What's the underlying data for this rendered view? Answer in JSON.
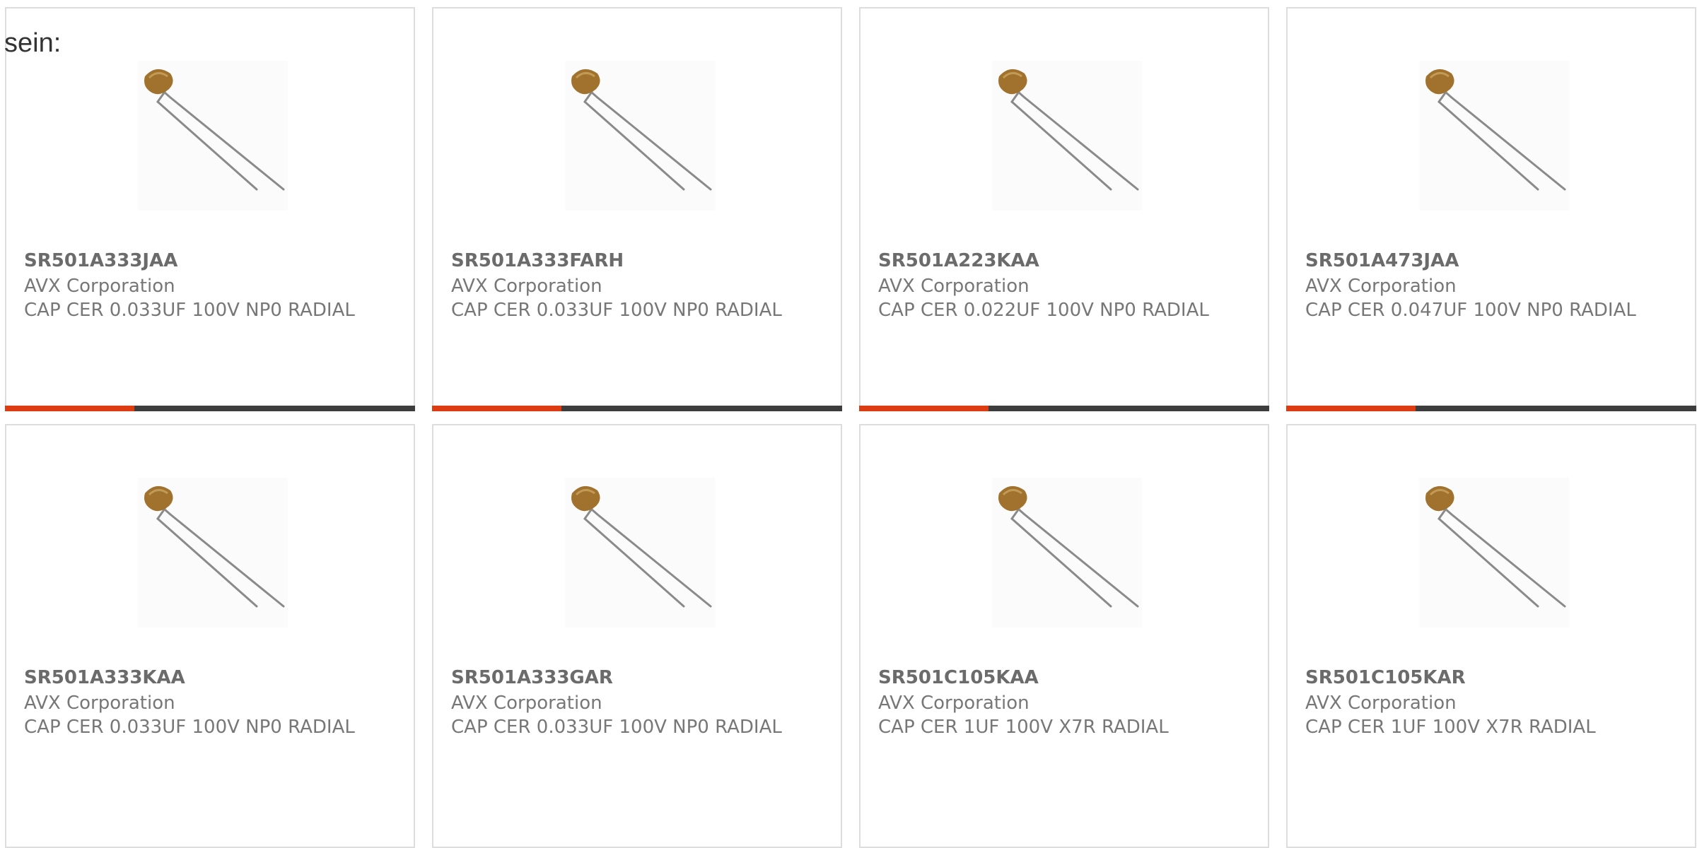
{
  "intro_text": "sein:",
  "colors": {
    "accent": "#dd3b12",
    "bar": "#3d3d3d",
    "border": "#dddddd"
  },
  "products": [
    {
      "part": "SR501A333JAA",
      "manufacturer": "AVX Corporation",
      "description": "CAP CER 0.033UF 100V NP0 RADIAL",
      "image_icon": "ceramic-capacitor-icon"
    },
    {
      "part": "SR501A333FARH",
      "manufacturer": "AVX Corporation",
      "description": "CAP CER 0.033UF 100V NP0 RADIAL",
      "image_icon": "ceramic-capacitor-icon"
    },
    {
      "part": "SR501A223KAA",
      "manufacturer": "AVX Corporation",
      "description": "CAP CER 0.022UF 100V NP0 RADIAL",
      "image_icon": "ceramic-capacitor-icon"
    },
    {
      "part": "SR501A473JAA",
      "manufacturer": "AVX Corporation",
      "description": "CAP CER 0.047UF 100V NP0 RADIAL",
      "image_icon": "ceramic-capacitor-icon"
    },
    {
      "part": "SR501A333KAA",
      "manufacturer": "AVX Corporation",
      "description": "CAP CER 0.033UF 100V NP0 RADIAL",
      "image_icon": "ceramic-capacitor-icon"
    },
    {
      "part": "SR501A333GAR",
      "manufacturer": "AVX Corporation",
      "description": "CAP CER 0.033UF 100V NP0 RADIAL",
      "image_icon": "ceramic-capacitor-icon"
    },
    {
      "part": "SR501C105KAA",
      "manufacturer": "AVX Corporation",
      "description": "CAP CER 1UF 100V X7R RADIAL",
      "image_icon": "ceramic-capacitor-icon"
    },
    {
      "part": "SR501C105KAR",
      "manufacturer": "AVX Corporation",
      "description": "CAP CER 1UF 100V X7R RADIAL",
      "image_icon": "ceramic-capacitor-icon"
    }
  ]
}
